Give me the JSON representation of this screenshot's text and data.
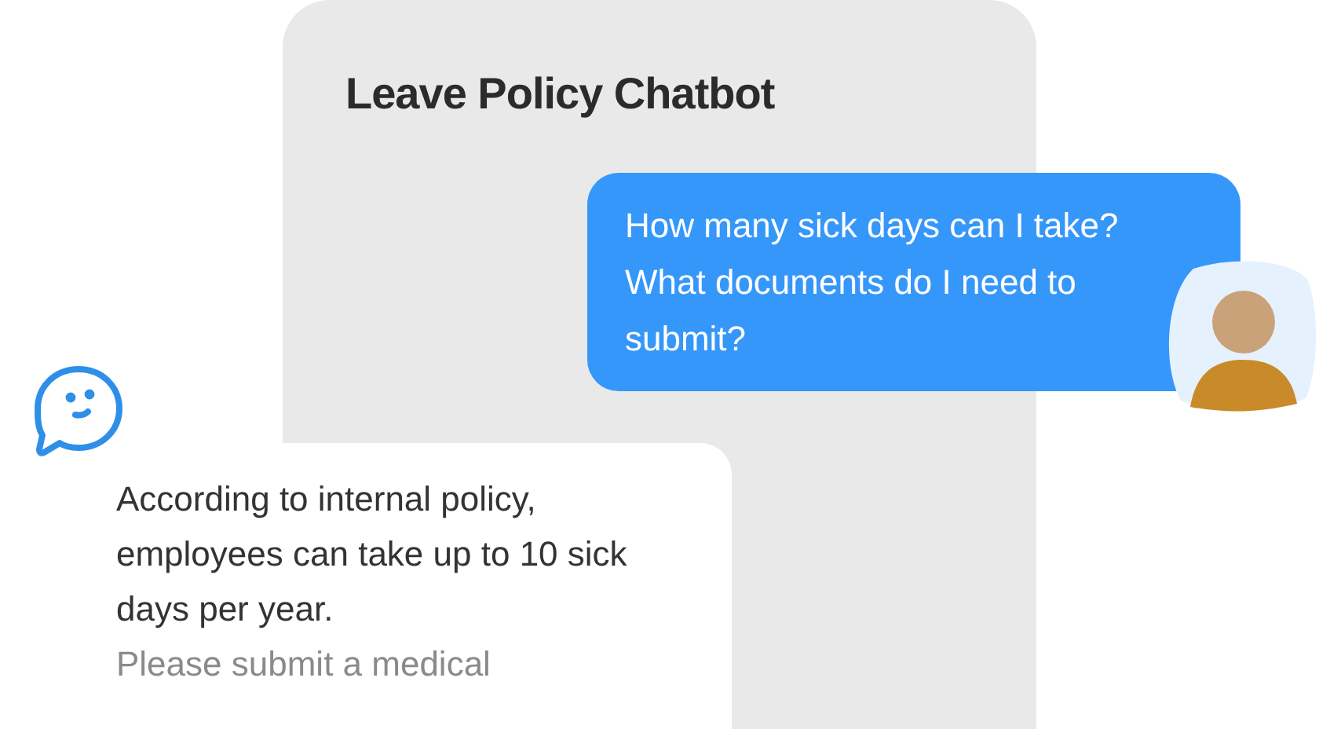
{
  "chat_window": {
    "title": "Leave Policy Chatbot"
  },
  "messages": [
    {
      "kind": "user",
      "text": "How many sick days can I take? What documents do I need to submit?"
    },
    {
      "kind": "bot",
      "paragraphs": [
        "According to internal policy, employees can take up to 10 sick days per year.",
        "Please submit a medical"
      ]
    }
  ]
}
